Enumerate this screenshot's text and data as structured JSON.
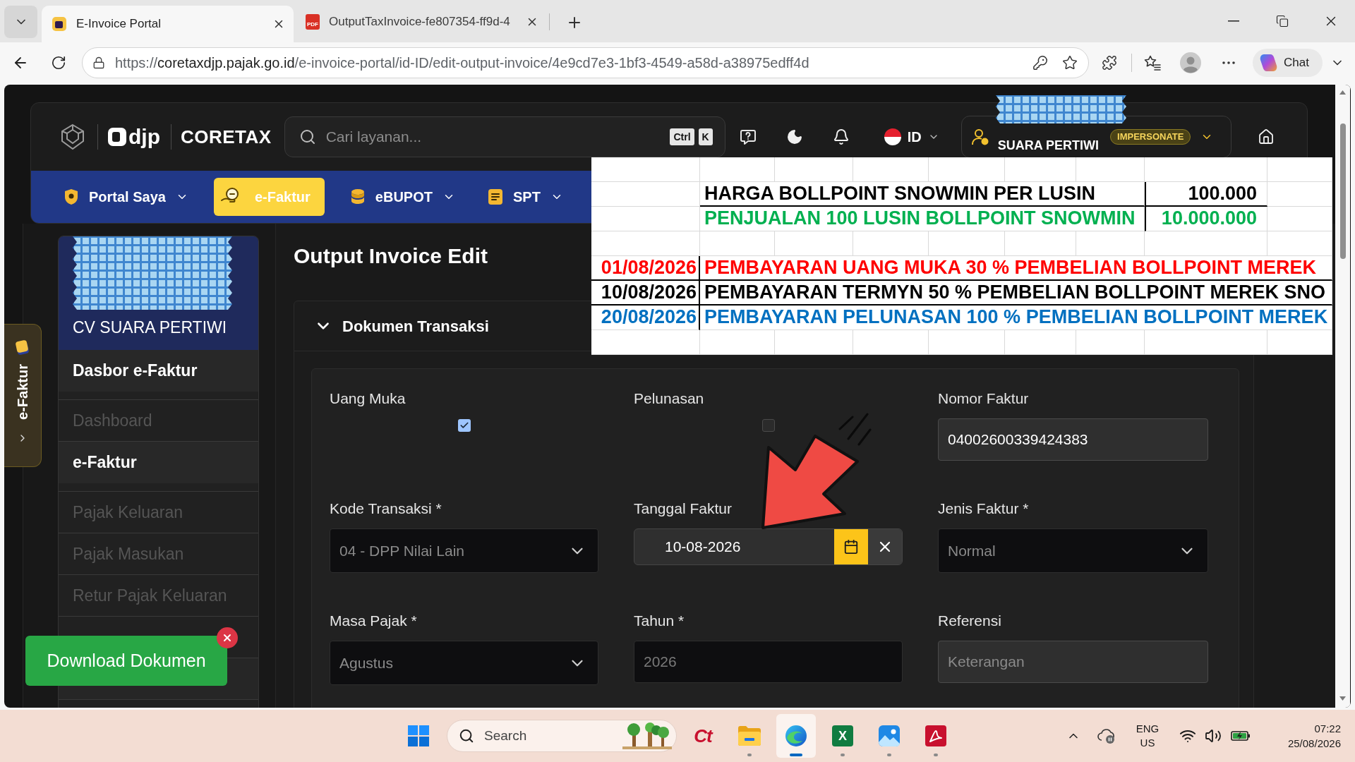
{
  "browser": {
    "tabs": [
      {
        "title": "E-Invoice Portal",
        "kind": "portal",
        "selected": true
      },
      {
        "title": "OutputTaxInvoice-fe807354-ff9d-4",
        "kind": "pdf",
        "badge": "PDF",
        "selected": false
      }
    ],
    "address": {
      "scheme": "https://",
      "host": "coretaxdjp.pajak.go.id",
      "path": "/e-invoice-portal/id-ID/edit-output-invoice/4e9cd7e3-1bf3-4549-a58d-a38975edff4d"
    },
    "chat_label": "Chat"
  },
  "header": {
    "brand": "djp",
    "product": "CORETAX",
    "search": {
      "placeholder": "Cari layanan...",
      "keys": [
        "Ctrl",
        "K"
      ]
    },
    "language": "ID",
    "user": {
      "name": "SUARA PERTIWI",
      "badge": "IMPERSONATE"
    }
  },
  "nav": [
    {
      "label": "Portal Saya",
      "kind": "shield",
      "dropdown": true,
      "selected": false
    },
    {
      "label": "e-Faktur",
      "kind": "coin",
      "dropdown": false,
      "selected": true
    },
    {
      "label": "eBUPOT",
      "kind": "stack",
      "dropdown": true,
      "selected": false
    },
    {
      "label": "SPT",
      "kind": "document",
      "dropdown": true,
      "selected": false
    }
  ],
  "side_tab": {
    "label": "e-Faktur"
  },
  "sidebar": {
    "company": "CV SUARA PERTIWI",
    "items": [
      {
        "label": "Dasbor e-Faktur",
        "kind": "heading"
      },
      {
        "label": "Dashboard",
        "kind": "link"
      },
      {
        "label": "e-Faktur",
        "kind": "heading"
      },
      {
        "label": "Pajak Keluaran",
        "kind": "link"
      },
      {
        "label": "Pajak Masukan",
        "kind": "link"
      },
      {
        "label": "Retur Pajak Keluaran",
        "kind": "link"
      }
    ]
  },
  "page_title": "Output Invoice Edit",
  "section": {
    "title": "Dokumen Transaksi",
    "expanded": true,
    "fields": [
      {
        "kind": "checkbox",
        "label": "Uang Muka",
        "checked": true
      },
      {
        "kind": "checkbox",
        "label": "Pelunasan",
        "checked": false
      },
      {
        "kind": "text",
        "label": "Nomor Faktur",
        "value": "04002600339424383",
        "disabled": false
      },
      {
        "kind": "select",
        "label": "Kode Transaksi *",
        "value": "04 - DPP Nilai Lain",
        "disabled": true
      },
      {
        "kind": "date",
        "label": "Tanggal Faktur",
        "value": "10-08-2026"
      },
      {
        "kind": "select",
        "label": "Jenis Faktur *",
        "value": "Normal",
        "disabled": true
      },
      {
        "kind": "select",
        "label": "Masa Pajak *",
        "value": "Agustus",
        "disabled": true
      },
      {
        "kind": "text",
        "label": "Tahun *",
        "value": "2026",
        "disabled": true
      },
      {
        "kind": "text",
        "label": "Referensi",
        "placeholder": "Keterangan",
        "disabled": false
      }
    ]
  },
  "spreadsheet": {
    "rows": [
      {
        "kind": "blank"
      },
      {
        "kind": "amount",
        "label": "HARGA BOLLPOINT SNOWMIN PER LUSIN",
        "value": "100.000",
        "color": "#000000"
      },
      {
        "kind": "amount",
        "label": "PENJUALAN 100 LUSIN BOLLPOINT SNOWMIN",
        "value": "10.000.000",
        "color": "#00b050"
      },
      {
        "kind": "blank"
      },
      {
        "kind": "dated",
        "date": "01/08/2026",
        "label": "PEMBAYARAN UANG MUKA 30 % PEMBELIAN BOLLPOINT MEREK",
        "color": "#ff0000"
      },
      {
        "kind": "dated",
        "date": "10/08/2026",
        "label": "PEMBAYARAN TERMYN 50 % PEMBELIAN BOLLPOINT MEREK SNO",
        "color": "#000000"
      },
      {
        "kind": "dated",
        "date": "20/08/2026",
        "label": "PEMBAYARAN PELUNASAN 100 % PEMBELIAN BOLLPOINT MEREK",
        "color": "#0070c0"
      },
      {
        "kind": "blank"
      }
    ]
  },
  "toast": {
    "label": "Download Dokumen"
  },
  "taskbar": {
    "search": {
      "placeholder": "Search"
    },
    "apps": [
      {
        "kind": "ct",
        "glyph": "Ct",
        "running": false,
        "selected": false
      },
      {
        "kind": "folder",
        "running": true,
        "selected": false
      },
      {
        "kind": "browser",
        "running": true,
        "selected": true
      },
      {
        "kind": "spreadsheet",
        "glyph": "X",
        "running": true,
        "selected": false
      },
      {
        "kind": "photos",
        "running": true,
        "selected": false
      },
      {
        "kind": "pdf",
        "running": true,
        "selected": false
      }
    ],
    "language": [
      "ENG",
      "US"
    ],
    "time": "07:22",
    "date": "25/08/2026"
  }
}
